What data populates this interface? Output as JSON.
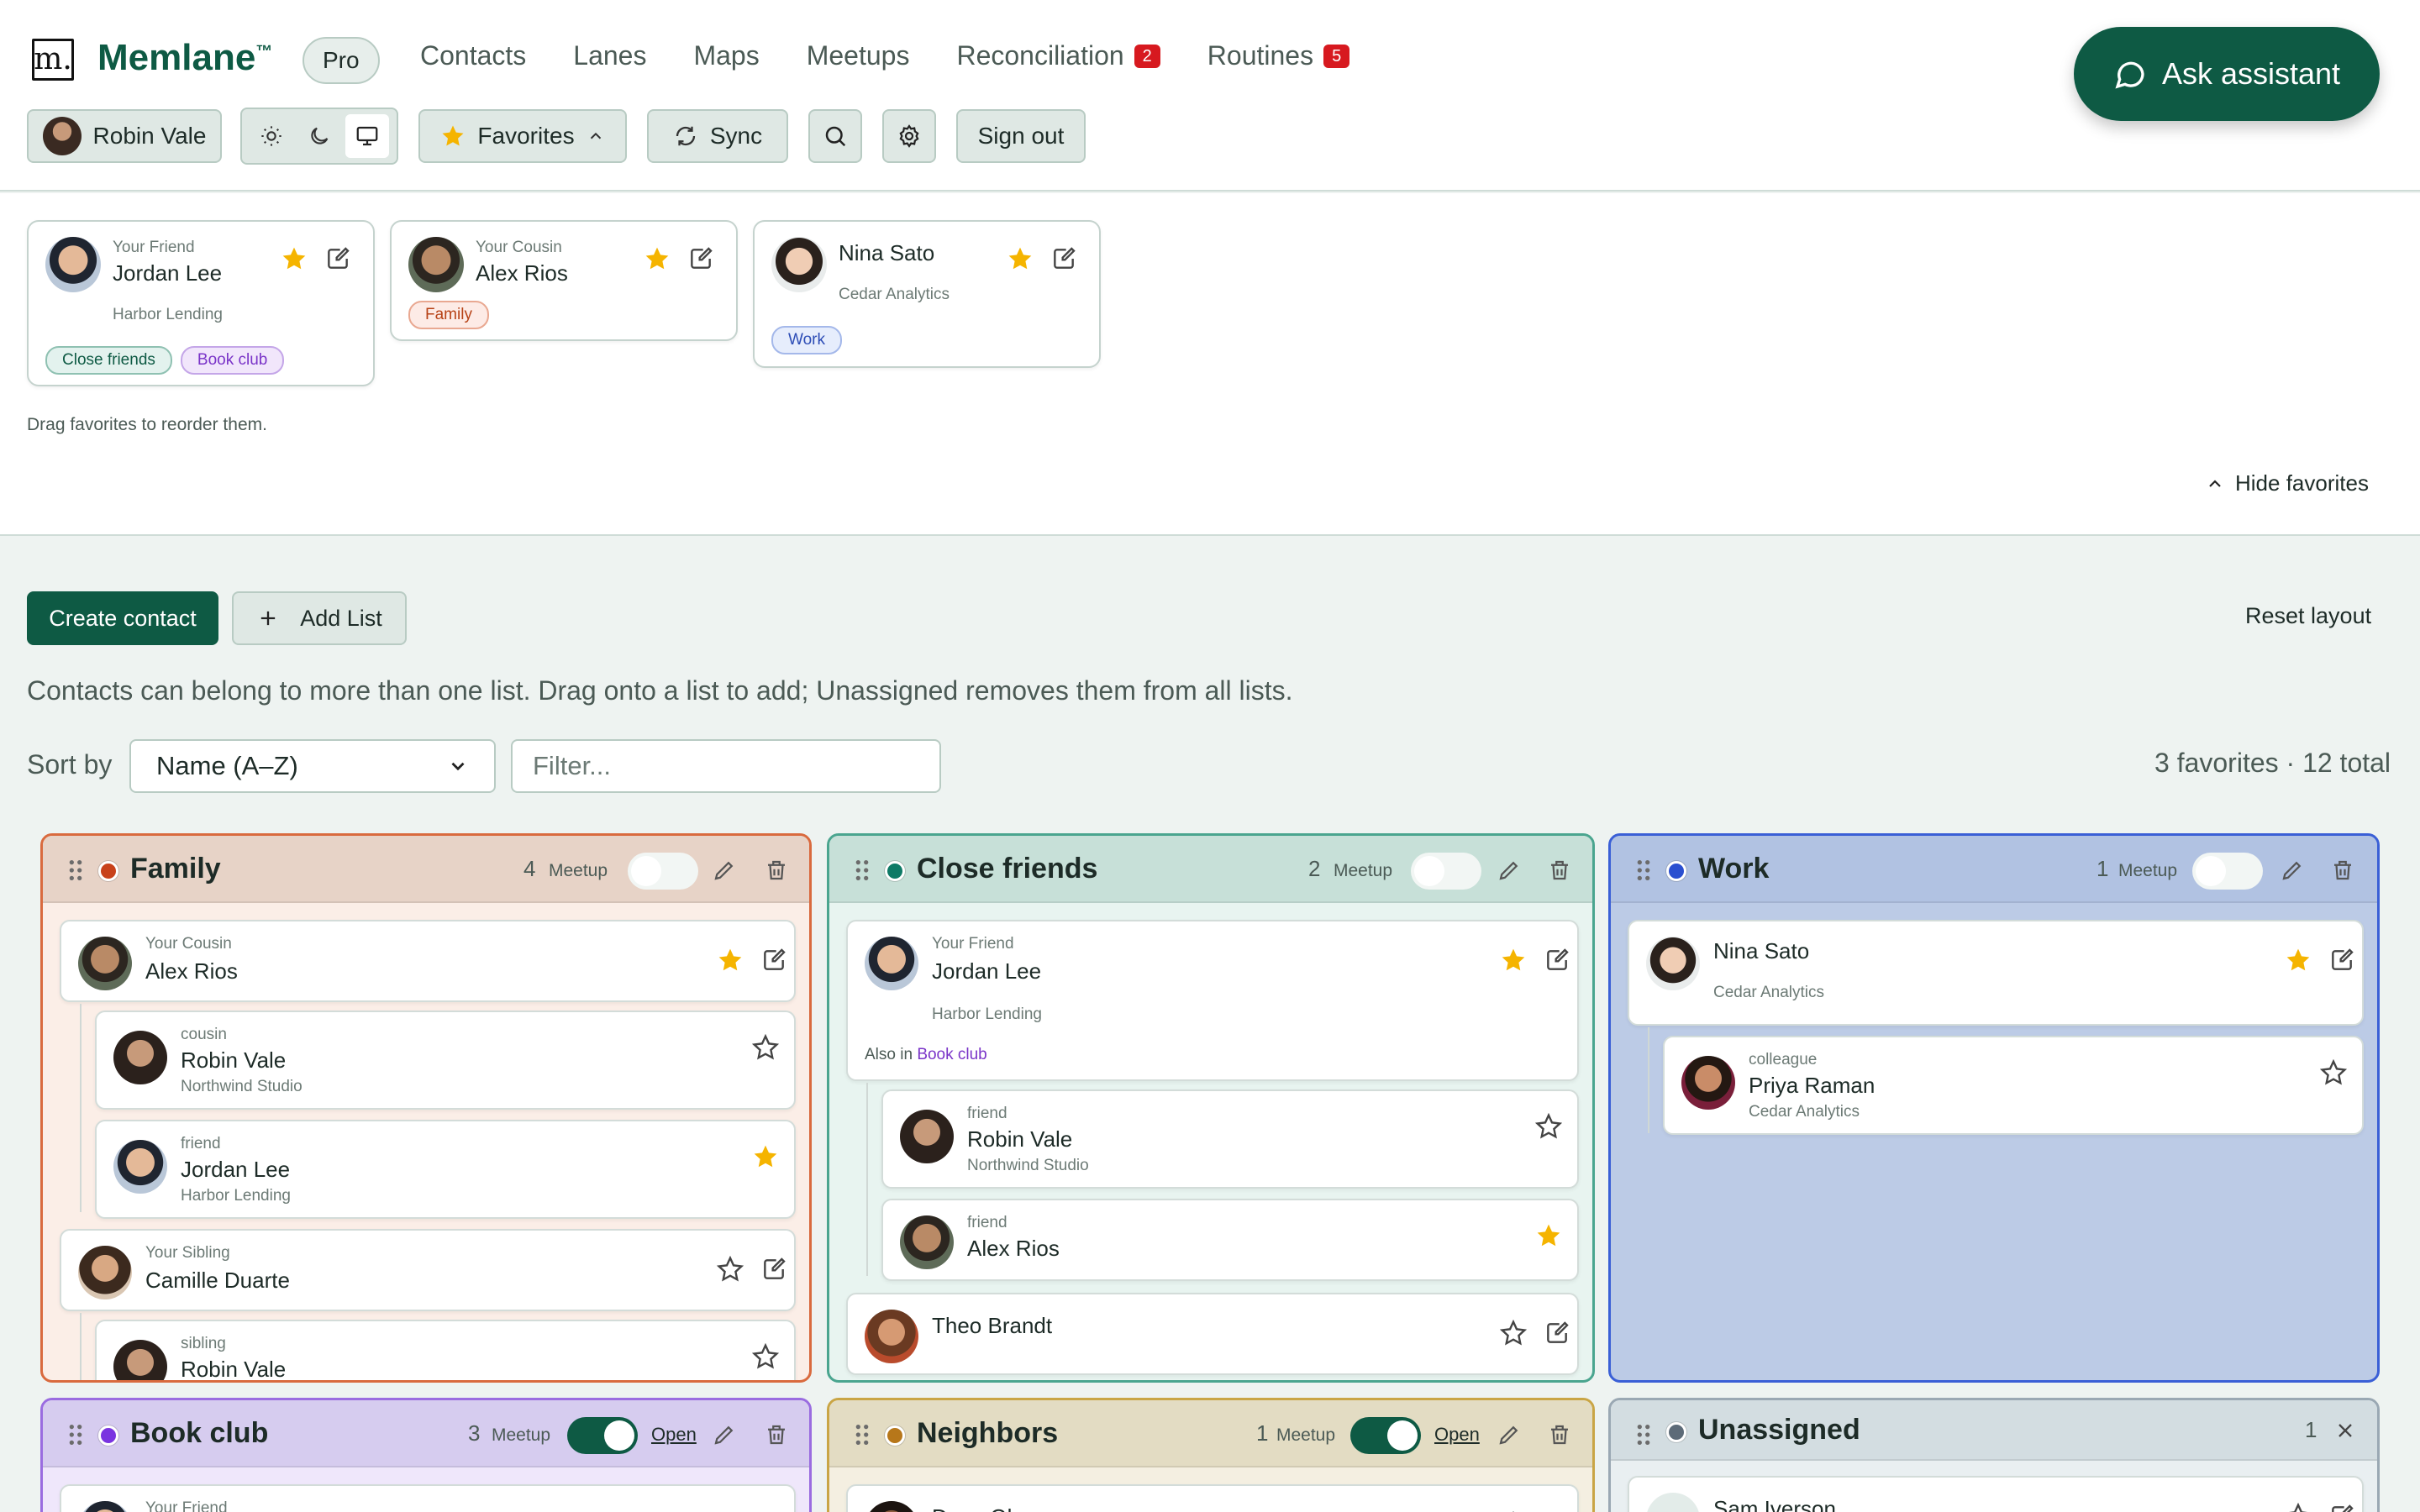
{
  "app": {
    "logo_letter": "m.",
    "brand": "Memlane",
    "trademark": "™",
    "plan": "Pro"
  },
  "nav": [
    {
      "label": "Contacts"
    },
    {
      "label": "Lanes"
    },
    {
      "label": "Maps"
    },
    {
      "label": "Meetups"
    },
    {
      "label": "Reconciliation",
      "badge": "2"
    },
    {
      "label": "Routines",
      "badge": "5"
    }
  ],
  "assistant": {
    "label": "Ask assistant",
    "icon": "chat-bubble-icon"
  },
  "toolbar": {
    "user_name": "Robin Vale",
    "theme_options": [
      "light-sun-icon",
      "dark-moon-icon",
      "system-monitor-icon"
    ],
    "favorites_label": "Favorites",
    "sync_label": "Sync",
    "sign_out_label": "Sign out"
  },
  "favorites": {
    "cards": [
      {
        "relation": "Your Friend",
        "name": "Jordan Lee",
        "org": "Harbor Lending",
        "tags": [
          "Close friends",
          "Book club"
        ],
        "starred": true
      },
      {
        "relation": "Your Cousin",
        "name": "Alex Rios",
        "org": "",
        "tags": [
          "Family"
        ],
        "starred": true
      },
      {
        "relation": "",
        "name": "Nina Sato",
        "org": "Cedar Analytics",
        "tags": [
          "Work"
        ],
        "starred": true
      }
    ],
    "hint": "Drag favorites to reorder them.",
    "hide_label": "Hide favorites"
  },
  "actions": {
    "create_contact": "Create contact",
    "add_list": "Add List",
    "reset_layout": "Reset layout"
  },
  "help_text": "Contacts can belong to more than one list. Drag onto a list to add; Unassigned removes them from all lists.",
  "sort": {
    "label": "Sort by",
    "selected": "Name (A–Z)",
    "filter_placeholder": "Filter..."
  },
  "totals": "3 favorites · 12 total",
  "lanes": {
    "family": {
      "title": "Family",
      "count": "4",
      "meetup_label": "Meetup",
      "meetup_on": false,
      "color": "#c8421b",
      "cards": [
        {
          "relation": "Your Cousin",
          "name": "Alex Rios"
        },
        {
          "relation": "cousin",
          "name": "Robin Vale",
          "org": "Northwind Studio"
        },
        {
          "relation": "friend",
          "name": "Jordan Lee",
          "org": "Harbor Lending"
        },
        {
          "relation": "Your Sibling",
          "name": "Camille Duarte"
        },
        {
          "relation": "sibling",
          "name": "Robin Vale"
        }
      ]
    },
    "close": {
      "title": "Close friends",
      "count": "2",
      "meetup_label": "Meetup",
      "meetup_on": false,
      "color": "#0e7a66",
      "cards": [
        {
          "relation": "Your Friend",
          "name": "Jordan Lee",
          "org": "Harbor Lending",
          "also_prefix": "Also in",
          "also_list": "Book club"
        },
        {
          "relation": "friend",
          "name": "Robin Vale",
          "org": "Northwind Studio"
        },
        {
          "relation": "friend",
          "name": "Alex Rios"
        },
        {
          "relation": "",
          "name": "Theo Brandt"
        }
      ]
    },
    "work": {
      "title": "Work",
      "count": "1",
      "meetup_label": "Meetup",
      "meetup_on": false,
      "color": "#2a4fd0",
      "cards": [
        {
          "relation": "",
          "name": "Nina Sato",
          "org": "Cedar Analytics"
        },
        {
          "relation": "colleague",
          "name": "Priya Raman",
          "org": "Cedar Analytics"
        }
      ]
    },
    "book": {
      "title": "Book club",
      "count": "3",
      "meetup_label": "Meetup",
      "meetup_on": true,
      "open_label": "Open",
      "color": "#7a34e0",
      "cards": [
        {
          "relation": "Your Friend",
          "name": ""
        }
      ]
    },
    "neighbors": {
      "title": "Neighbors",
      "count": "1",
      "meetup_label": "Meetup",
      "meetup_on": true,
      "open_label": "Open",
      "color": "#b7771a",
      "cards": [
        {
          "relation": "",
          "name": "Dana Okoye"
        }
      ]
    },
    "unassigned": {
      "title": "Unassigned",
      "count": "1",
      "color": "#5d6b78",
      "cards": [
        {
          "relation": "",
          "name": "Sam Iverson"
        }
      ]
    }
  },
  "colors": {
    "brand": "#0e5a44",
    "badge": "#d7191f",
    "star": "#f5b400",
    "toggle_on": "#0e5a44"
  }
}
